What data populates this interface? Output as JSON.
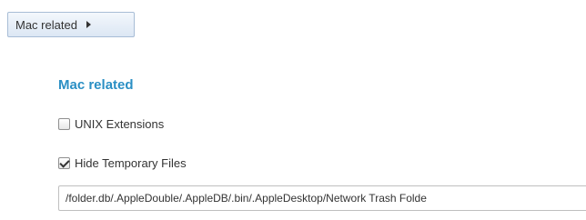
{
  "toolbar": {
    "menu_label": "Mac related",
    "menu_icon": "caret-right-icon"
  },
  "section": {
    "title": "Mac related"
  },
  "options": {
    "unix_extensions": {
      "label": "UNIX Extensions",
      "checked": false
    },
    "hide_temp_files": {
      "label": "Hide Temporary Files",
      "checked": true
    }
  },
  "veto_files": {
    "value": "/folder.db/.AppleDouble/.AppleDB/.bin/.AppleDesktop/Network Trash Folde"
  },
  "colors": {
    "accent": "#2a8fc4",
    "button_border": "#a8bdd6"
  }
}
